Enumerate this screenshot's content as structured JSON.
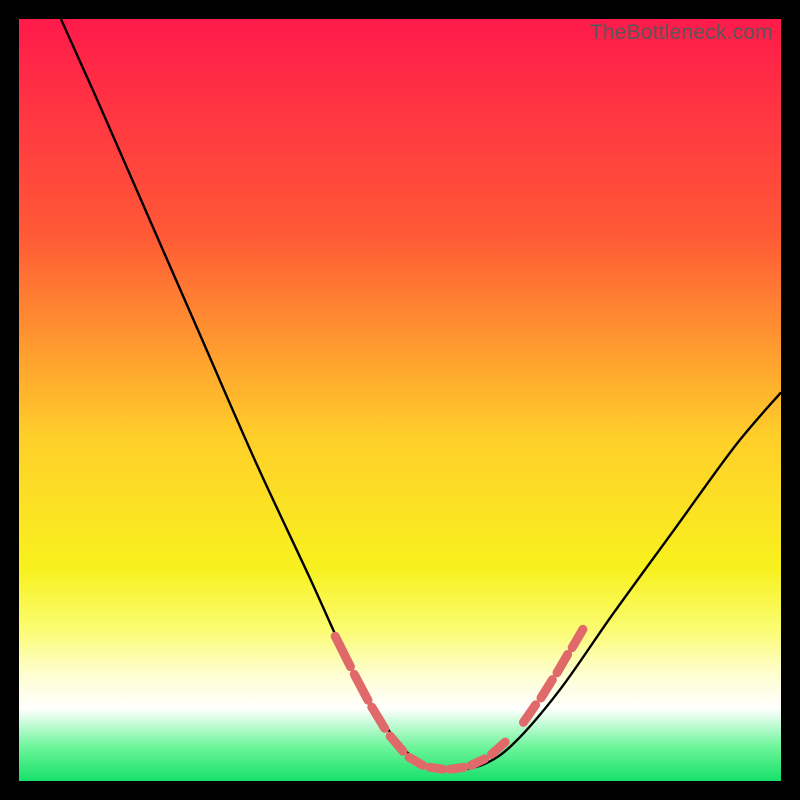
{
  "watermark": "TheBottleneck.com",
  "chart_data": {
    "type": "line",
    "title": "",
    "xlabel": "",
    "ylabel": "",
    "xlim": [
      0,
      100
    ],
    "ylim": [
      0,
      100
    ],
    "gradient_stops": [
      {
        "offset": 0,
        "color": "#ff1a4b"
      },
      {
        "offset": 0.28,
        "color": "#ff5836"
      },
      {
        "offset": 0.55,
        "color": "#ffcf2a"
      },
      {
        "offset": 0.72,
        "color": "#f8f11e"
      },
      {
        "offset": 0.8,
        "color": "#fbfc70"
      },
      {
        "offset": 0.86,
        "color": "#fefed0"
      },
      {
        "offset": 0.905,
        "color": "#ffffff"
      },
      {
        "offset": 0.955,
        "color": "#6df59a"
      },
      {
        "offset": 1.0,
        "color": "#17e06a"
      }
    ],
    "series": [
      {
        "name": "bottleneck-curve",
        "color": "#000000",
        "points": [
          {
            "x": 5.5,
            "y": 100
          },
          {
            "x": 10,
            "y": 90
          },
          {
            "x": 17,
            "y": 74
          },
          {
            "x": 24,
            "y": 58
          },
          {
            "x": 31,
            "y": 42
          },
          {
            "x": 38,
            "y": 27
          },
          {
            "x": 44,
            "y": 14
          },
          {
            "x": 49,
            "y": 6
          },
          {
            "x": 53,
            "y": 2.2
          },
          {
            "x": 57,
            "y": 1.5
          },
          {
            "x": 61,
            "y": 2.2
          },
          {
            "x": 65,
            "y": 5
          },
          {
            "x": 71,
            "y": 12
          },
          {
            "x": 78,
            "y": 22
          },
          {
            "x": 86,
            "y": 33
          },
          {
            "x": 94,
            "y": 44
          },
          {
            "x": 100,
            "y": 51
          }
        ]
      }
    ],
    "dash_segments": [
      {
        "x1": 41.5,
        "y1": 19,
        "x2": 43.5,
        "y2": 15.0
      },
      {
        "x1": 44.0,
        "y1": 14.0,
        "x2": 45.8,
        "y2": 10.6
      },
      {
        "x1": 46.3,
        "y1": 9.7,
        "x2": 48.0,
        "y2": 6.9
      },
      {
        "x1": 48.7,
        "y1": 5.9,
        "x2": 50.4,
        "y2": 3.9
      },
      {
        "x1": 51.2,
        "y1": 3.1,
        "x2": 53.0,
        "y2": 2.05
      },
      {
        "x1": 53.9,
        "y1": 1.8,
        "x2": 55.7,
        "y2": 1.55
      },
      {
        "x1": 56.6,
        "y1": 1.55,
        "x2": 58.4,
        "y2": 1.8
      },
      {
        "x1": 59.3,
        "y1": 2.05,
        "x2": 61.1,
        "y2": 2.9
      },
      {
        "x1": 62.0,
        "y1": 3.5,
        "x2": 63.8,
        "y2": 5.1
      },
      {
        "x1": 66.2,
        "y1": 7.7,
        "x2": 67.8,
        "y2": 10.0
      },
      {
        "x1": 68.5,
        "y1": 10.9,
        "x2": 70.0,
        "y2": 13.3
      },
      {
        "x1": 70.6,
        "y1": 14.2,
        "x2": 72.0,
        "y2": 16.6
      },
      {
        "x1": 72.6,
        "y1": 17.5,
        "x2": 74.0,
        "y2": 19.9
      }
    ],
    "dash_color": "#e06a6a"
  }
}
